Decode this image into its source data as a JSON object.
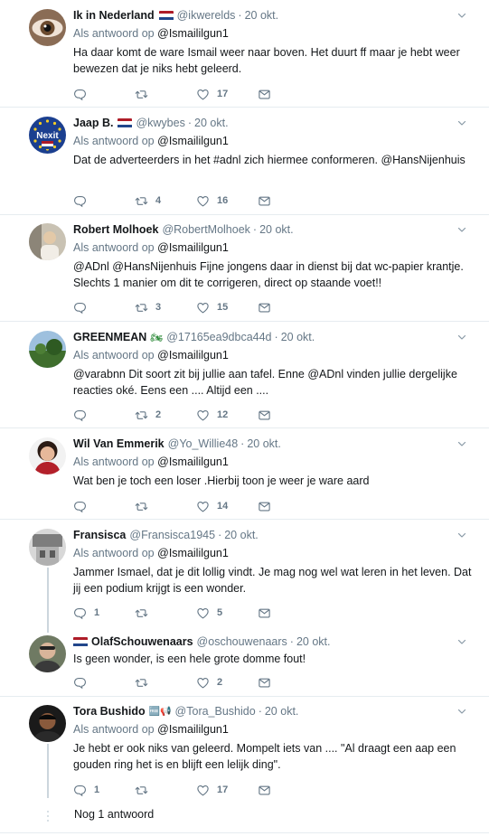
{
  "reply_prefix": "Als antwoord op",
  "tweets": [
    {
      "name": "Ik in Nederland",
      "flag": "nl",
      "handle": "@ikwerelds",
      "dot": "·",
      "time": "20 okt.",
      "reply_to": "@Ismaililgun1",
      "text": "Ha daar komt de ware Ismail weer naar boven. Het duurt ff maar je hebt weer bewezen dat je niks hebt geleerd.",
      "replies": "",
      "retweets": "",
      "likes": "17"
    },
    {
      "name": "Jaap B.",
      "flag": "nl",
      "handle": "@kwybes",
      "dot": "·",
      "time": "20 okt.",
      "reply_to": "@Ismaililgun1",
      "text": "Dat de adverteerders in het #adnl zich hiermee conformeren. @HansNijenhuis",
      "replies": "",
      "retweets": "4",
      "likes": "16",
      "avatar_label": "Nexit"
    },
    {
      "name": "Robert Molhoek",
      "handle": "@RobertMolhoek",
      "dot": "·",
      "time": "20 okt.",
      "reply_to": "@Ismaililgun1",
      "text": "@ADnl @HansNijenhuis Fijne jongens daar in dienst bij dat wc-papier krantje. Slechts 1 manier om dit te corrigeren, direct op staande voet!!",
      "replies": "",
      "retweets": "3",
      "likes": "15"
    },
    {
      "name": "GREENMEAN",
      "badge": "🏍",
      "handle": "@17165ea9dbca44d",
      "dot": "·",
      "time": "20 okt.",
      "reply_to": "@Ismaililgun1",
      "text": "@varabnn Dit soort zit bij jullie aan tafel. Enne @ADnl vinden jullie dergelijke reacties oké. Eens een .... Altijd een ....",
      "replies": "",
      "retweets": "2",
      "likes": "12"
    },
    {
      "name": "Wil Van Emmerik",
      "handle": "@Yo_Willie48",
      "dot": "·",
      "time": "20 okt.",
      "reply_to": "@Ismaililgun1",
      "text": "Wat ben je toch een loser  .Hierbij toon je weer je ware aard",
      "replies": "",
      "retweets": "",
      "likes": "14"
    },
    {
      "name": "Fransisca",
      "handle": "@Fransisca1945",
      "dot": "·",
      "time": "20 okt.",
      "reply_to": "@Ismaililgun1",
      "text": "Jammer Ismael, dat je dit lollig vindt. Je mag nog wel wat leren in het leven. Dat jij een podium krijgt is een wonder.",
      "replies": "1",
      "retweets": "",
      "likes": "5"
    },
    {
      "name": "OlafSchouwenaars",
      "flag_before": "nl",
      "handle": "@oschouwenaars",
      "dot": "·",
      "time": "20 okt.",
      "text": "Is geen wonder, is een hele grote domme fout!",
      "replies": "",
      "retweets": "",
      "likes": "2"
    },
    {
      "name": "Tora Bushido",
      "badge": "🆓📢",
      "handle": "@Tora_Bushido",
      "dot": "·",
      "time": "20 okt.",
      "reply_to": "@Ismaililgun1",
      "text": "Je hebt er ook niks van geleerd. Mompelt iets van .... \"Al draagt een aap een gouden ring het is en blijft een lelijk ding\".",
      "replies": "1",
      "retweets": "",
      "likes": "17"
    }
  ],
  "more_replies": "Nog 1 antwoord",
  "colors": {
    "text": "#14171a",
    "muted": "#657786",
    "separator": "#e6ecf0",
    "thread_line": "#ccd6dd"
  }
}
